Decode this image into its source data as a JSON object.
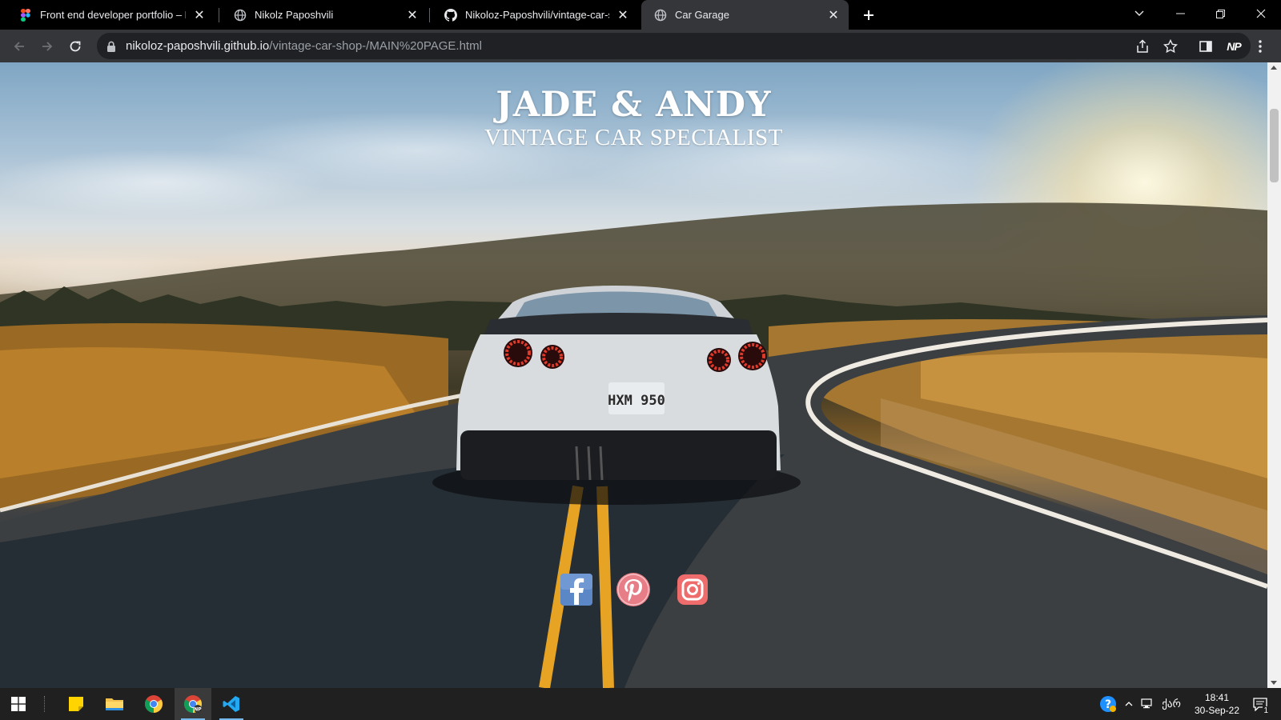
{
  "browser": {
    "tabs": [
      {
        "title": "Front end developer portfolio – F",
        "favicon": "figma-icon",
        "active": false
      },
      {
        "title": "Nikolz Paposhvili",
        "favicon": "globe-icon",
        "active": false
      },
      {
        "title": "Nikoloz-Paposhvili/vintage-car-sl",
        "favicon": "github-icon",
        "active": false
      },
      {
        "title": "Car Garage",
        "favicon": "globe-icon",
        "active": true
      }
    ],
    "url_host": "nikoloz-paposhvili.github.io",
    "url_path": "/vintage-car-shop-/MAIN%20PAGE.html",
    "profile_initials": "NP"
  },
  "page": {
    "title": "JADE & ANDY",
    "subtitle": "VINTAGE CAR SPECIALIST",
    "plate": "HXM 950",
    "social": [
      {
        "name": "facebook",
        "icon": "facebook-icon",
        "color": "#3b5998"
      },
      {
        "name": "pinterest",
        "icon": "pinterest-icon",
        "color": "#e77d86"
      },
      {
        "name": "instagram",
        "icon": "instagram-icon",
        "color": "#ee6c6c"
      }
    ]
  },
  "taskbar": {
    "apps": [
      "windows-start",
      "sticky-notes",
      "file-explorer",
      "chrome",
      "chrome-profile",
      "vscode"
    ],
    "keyboard_lang": "ქარ",
    "time": "18:41",
    "date": "30-Sep-22",
    "notification_count": "1"
  }
}
